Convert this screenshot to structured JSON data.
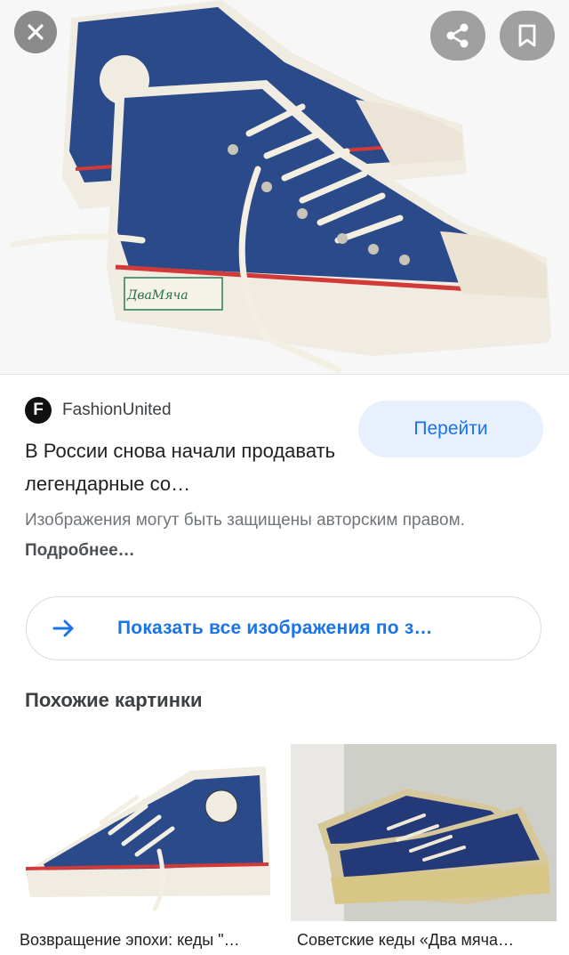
{
  "viewer": {
    "close_icon": "close-icon",
    "share_icon": "share-icon",
    "bookmark_icon": "bookmark-icon",
    "hero_image_brand_text": "ДваМяча"
  },
  "source": {
    "logo_letter": "F",
    "name": "FashionUnited",
    "goto_label": "Перейти"
  },
  "result": {
    "title": "В России снова начали продавать легендарные со…",
    "copyright_text": "Изображения могут быть защищены авторским правом.",
    "more_link": "Подробнее…"
  },
  "show_all": {
    "label": "Показать все изображения по з…",
    "icon": "arrow-right-icon"
  },
  "related": {
    "title": "Похожие картинки",
    "items": [
      {
        "caption": "Возвращение эпохи: кеды \"…"
      },
      {
        "caption": "Советские кеды «Два мяча…"
      }
    ]
  },
  "colors": {
    "accent": "#1a73e8",
    "button_bg": "#e8f0fe",
    "shoe_blue": "#2b4a8a",
    "stripe_red": "#d23a3a"
  }
}
